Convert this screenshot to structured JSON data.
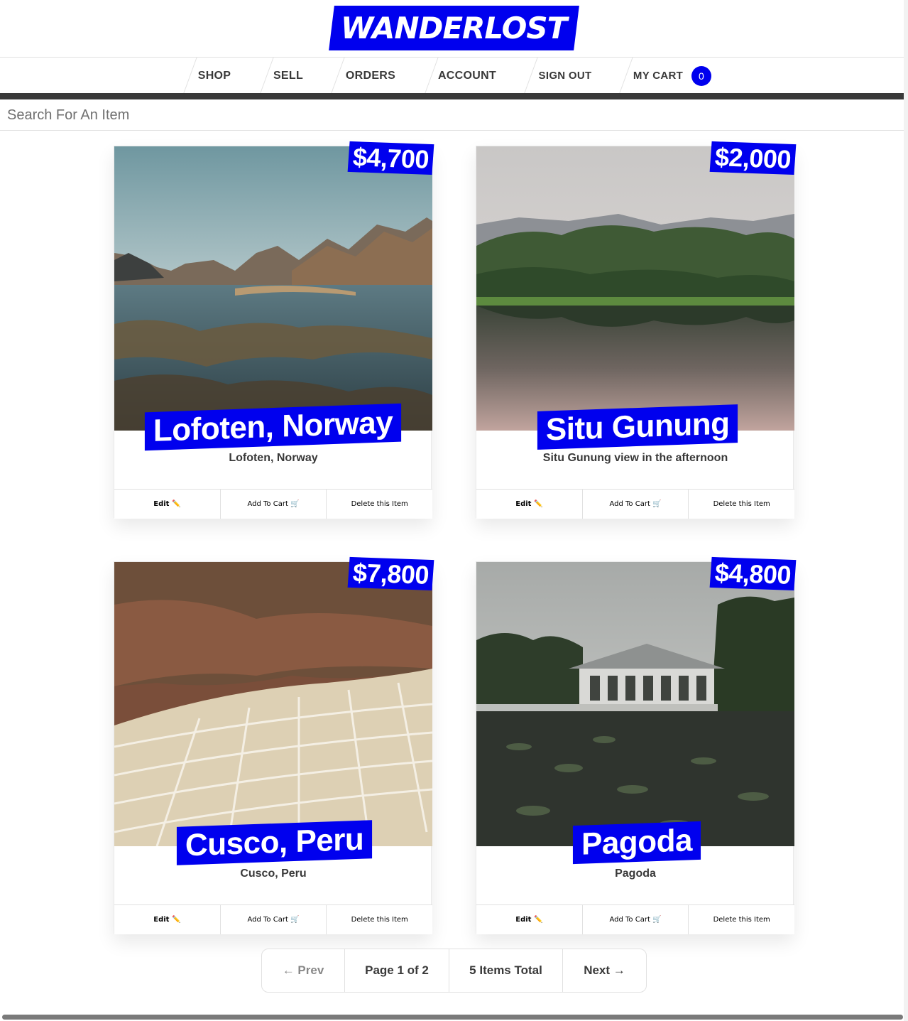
{
  "brand": {
    "logo_text": "WANDERLOST",
    "accent_color": "#0000ee"
  },
  "nav": {
    "items": [
      {
        "label": "SHOP"
      },
      {
        "label": "SELL"
      },
      {
        "label": "ORDERS"
      },
      {
        "label": "ACCOUNT"
      },
      {
        "label": "SIGN OUT"
      }
    ],
    "cart_label": "MY CART",
    "cart_count": "0"
  },
  "search": {
    "placeholder": "Search For An Item",
    "value": ""
  },
  "items": [
    {
      "price": "$4,700",
      "title": "Lofoten, Norway",
      "description": "Lofoten, Norway",
      "edit_label": "Edit ✏️",
      "add_label": "Add To Cart 🛒",
      "delete_label": "Delete this Item"
    },
    {
      "price": "$2,000",
      "title": "Situ Gunung",
      "description": "Situ Gunung view in the afternoon",
      "edit_label": "Edit ✏️",
      "add_label": "Add To Cart 🛒",
      "delete_label": "Delete this Item"
    },
    {
      "price": "$7,800",
      "title": "Cusco, Peru",
      "description": "Cusco, Peru",
      "edit_label": "Edit ✏️",
      "add_label": "Add To Cart 🛒",
      "delete_label": "Delete this Item"
    },
    {
      "price": "$4,800",
      "title": "Pagoda",
      "description": "Pagoda",
      "edit_label": "Edit ✏️",
      "add_label": "Add To Cart 🛒",
      "delete_label": "Delete this Item"
    }
  ],
  "pagination": {
    "prev_label": "← Prev",
    "page_label": "Page 1 of 2",
    "total_label": "5 Items Total",
    "next_label": "Next →"
  }
}
